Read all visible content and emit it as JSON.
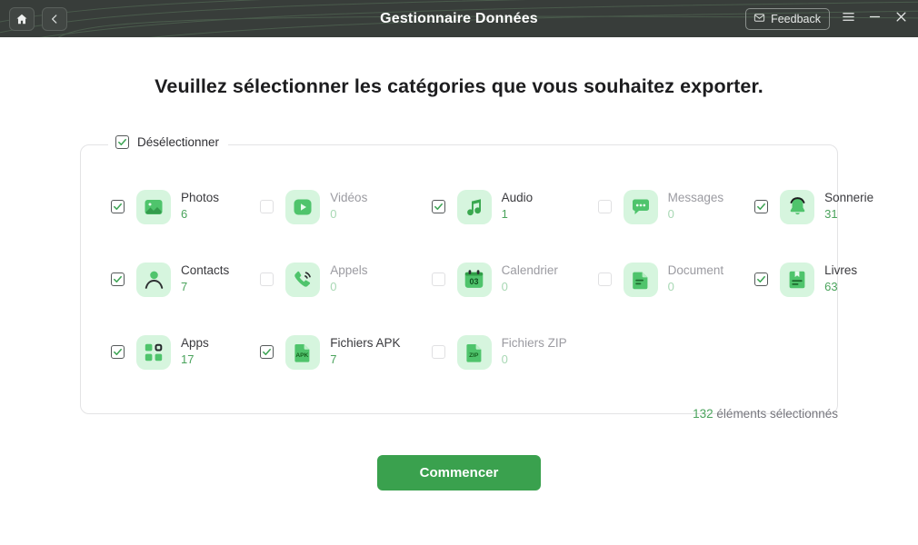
{
  "titlebar": {
    "title": "Gestionnaire Données",
    "home_icon": "home-icon",
    "back_icon": "chevron-left-icon",
    "feedback_label": "Feedback",
    "feedback_icon": "envelope-icon",
    "menu_icon": "hamburger-menu-icon",
    "minimize_icon": "minimize-icon",
    "close_icon": "close-icon",
    "bg_color": "#383d3a"
  },
  "heading": "Veuillez sélectionner les catégories que vous souhaitez exporter.",
  "panel": {
    "legend_label": "Désélectionner",
    "legend_checked": true
  },
  "categories": [
    {
      "name": "Photos",
      "count": "6",
      "checked": true,
      "icon": "photo-icon",
      "enabled": true
    },
    {
      "name": "Vidéos",
      "count": "0",
      "checked": false,
      "icon": "video-icon",
      "enabled": false
    },
    {
      "name": "Audio",
      "count": "1",
      "checked": true,
      "icon": "audio-icon",
      "enabled": true
    },
    {
      "name": "Messages",
      "count": "0",
      "checked": false,
      "icon": "message-icon",
      "enabled": false
    },
    {
      "name": "Sonnerie",
      "count": "31",
      "checked": true,
      "icon": "bell-icon",
      "enabled": true
    },
    {
      "name": "Contacts",
      "count": "7",
      "checked": true,
      "icon": "contact-icon",
      "enabled": true
    },
    {
      "name": "Appels",
      "count": "0",
      "checked": false,
      "icon": "phone-icon",
      "enabled": false
    },
    {
      "name": "Calendrier",
      "count": "0",
      "checked": false,
      "icon": "calendar-icon",
      "enabled": false
    },
    {
      "name": "Document",
      "count": "0",
      "checked": false,
      "icon": "document-icon",
      "enabled": false
    },
    {
      "name": "Livres",
      "count": "63",
      "checked": true,
      "icon": "book-icon",
      "enabled": true
    },
    {
      "name": "Apps",
      "count": "17",
      "checked": true,
      "icon": "apps-icon",
      "enabled": true
    },
    {
      "name": "Fichiers APK",
      "count": "7",
      "checked": true,
      "icon": "apk-file-icon",
      "enabled": true
    },
    {
      "name": "Fichiers ZIP",
      "count": "0",
      "checked": false,
      "icon": "zip-file-icon",
      "enabled": false
    }
  ],
  "footer": {
    "selected_number": "132",
    "selected_label": " éléments sélectionnés",
    "start_label": "Commencer",
    "accent_color": "#3aa14e"
  },
  "calendar_day": "03",
  "apk_label": "APK",
  "zip_label": "ZIP"
}
